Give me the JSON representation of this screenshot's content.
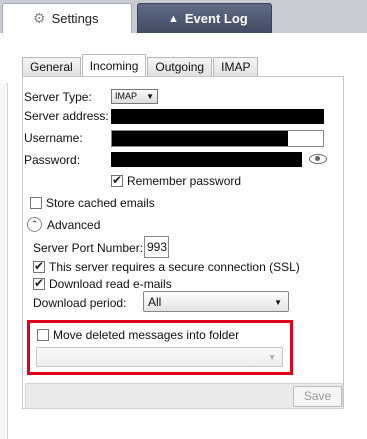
{
  "top_tabs": {
    "settings": {
      "label": "Settings",
      "icon": "gear-icon"
    },
    "event_log": {
      "label": "Event Log",
      "icon": "warning-icon"
    }
  },
  "sub_tabs": [
    "General",
    "Incoming",
    "Outgoing",
    "IMAP"
  ],
  "form": {
    "server_type_label": "Server Type:",
    "server_type_value": "IMAP",
    "server_address_label": "Server address:",
    "username_label": "Username:",
    "password_label": "Password:",
    "remember_password": "Remember password",
    "store_cached": "Store cached emails",
    "advanced": "Advanced",
    "server_port_label": "Server Port Number:",
    "server_port_value": "993",
    "secure_connection": "This server requires a secure connection (SSL)",
    "download_read": "Download read e-mails",
    "download_period_label": "Download period:",
    "download_period_value": "All",
    "move_deleted": "Move deleted messages into folder",
    "save": "Save"
  },
  "accent_red": "#e0001c"
}
